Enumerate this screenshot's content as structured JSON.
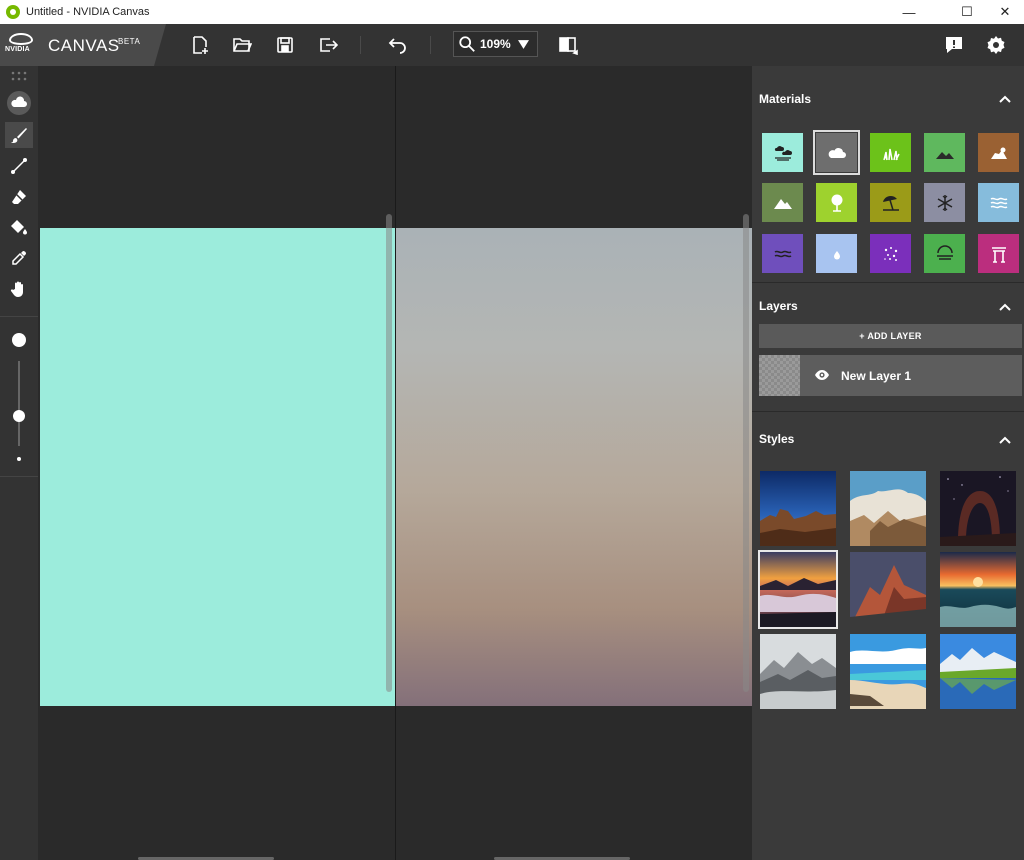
{
  "window": {
    "title": "Untitled - NVIDIA Canvas",
    "minimize": "—",
    "maximize": "☐",
    "close": "✕"
  },
  "header": {
    "brand_word": "NVIDIA",
    "app_name": "CANVAS",
    "badge": "BETA",
    "zoom_value": "109%"
  },
  "toolbar": {
    "icons": [
      "new-file-icon",
      "open-folder-icon",
      "save-icon",
      "export-icon",
      "undo-icon",
      "zoom-icon",
      "split-view-icon",
      "feedback-icon",
      "settings-icon"
    ]
  },
  "tools": {
    "icons": [
      "material-brush-icon",
      "paint-brush-icon",
      "line-icon",
      "eraser-icon",
      "fill-bucket-icon",
      "eyedropper-icon",
      "pan-hand-icon"
    ],
    "brush_size_level": 0.3
  },
  "canvas": {
    "segmentation_color": "#9cecdc"
  },
  "panels": {
    "materials": {
      "title": "Materials",
      "swatches": [
        {
          "name": "sky",
          "color": "#9cecdc",
          "icon": "clouds-icon"
        },
        {
          "name": "cloud",
          "color": "#6e6e6e",
          "icon": "cloud-icon",
          "selected": true
        },
        {
          "name": "grass",
          "color": "#6cc21a",
          "icon": "grass-icon"
        },
        {
          "name": "hill",
          "color": "#5fb85e",
          "icon": "hill-icon"
        },
        {
          "name": "rock",
          "color": "#9a6133",
          "icon": "rock-icon"
        },
        {
          "name": "mountain",
          "color": "#6c8a4e",
          "icon": "mountain-icon"
        },
        {
          "name": "tree",
          "color": "#9ed22e",
          "icon": "tree-icon"
        },
        {
          "name": "sand",
          "color": "#9b9b18",
          "icon": "beach-icon"
        },
        {
          "name": "snow",
          "color": "#8c8ea2",
          "icon": "snowflake-icon"
        },
        {
          "name": "water",
          "color": "#86bcdc",
          "icon": "water-icon"
        },
        {
          "name": "sea",
          "color": "#6f4fbc",
          "icon": "waves-icon"
        },
        {
          "name": "fog",
          "color": "#a8c4f0",
          "icon": "drop-icon"
        },
        {
          "name": "flower",
          "color": "#7b2fbb",
          "icon": "sparkle-icon"
        },
        {
          "name": "river",
          "color": "#4cb04e",
          "icon": "stream-icon"
        },
        {
          "name": "structure",
          "color": "#bb2e7e",
          "icon": "gate-icon"
        }
      ]
    },
    "layers": {
      "title": "Layers",
      "add_label": "+ ADD LAYER",
      "items": [
        {
          "label": "New Layer 1"
        }
      ]
    },
    "styles": {
      "title": "Styles",
      "thumbnails": [
        {
          "name": "night-desert"
        },
        {
          "name": "cloudy-peaks"
        },
        {
          "name": "starry-arch"
        },
        {
          "name": "sunset-fog",
          "selected": true
        },
        {
          "name": "red-peaks"
        },
        {
          "name": "ocean-sunset"
        },
        {
          "name": "misty-mountains"
        },
        {
          "name": "beach-sky"
        },
        {
          "name": "alpine-lake"
        }
      ]
    }
  },
  "colors": {
    "accent": "#76b900",
    "toolbar_bg": "#333333",
    "panel_bg": "#3a3a3a",
    "workspace_bg": "#2a2a2a"
  }
}
